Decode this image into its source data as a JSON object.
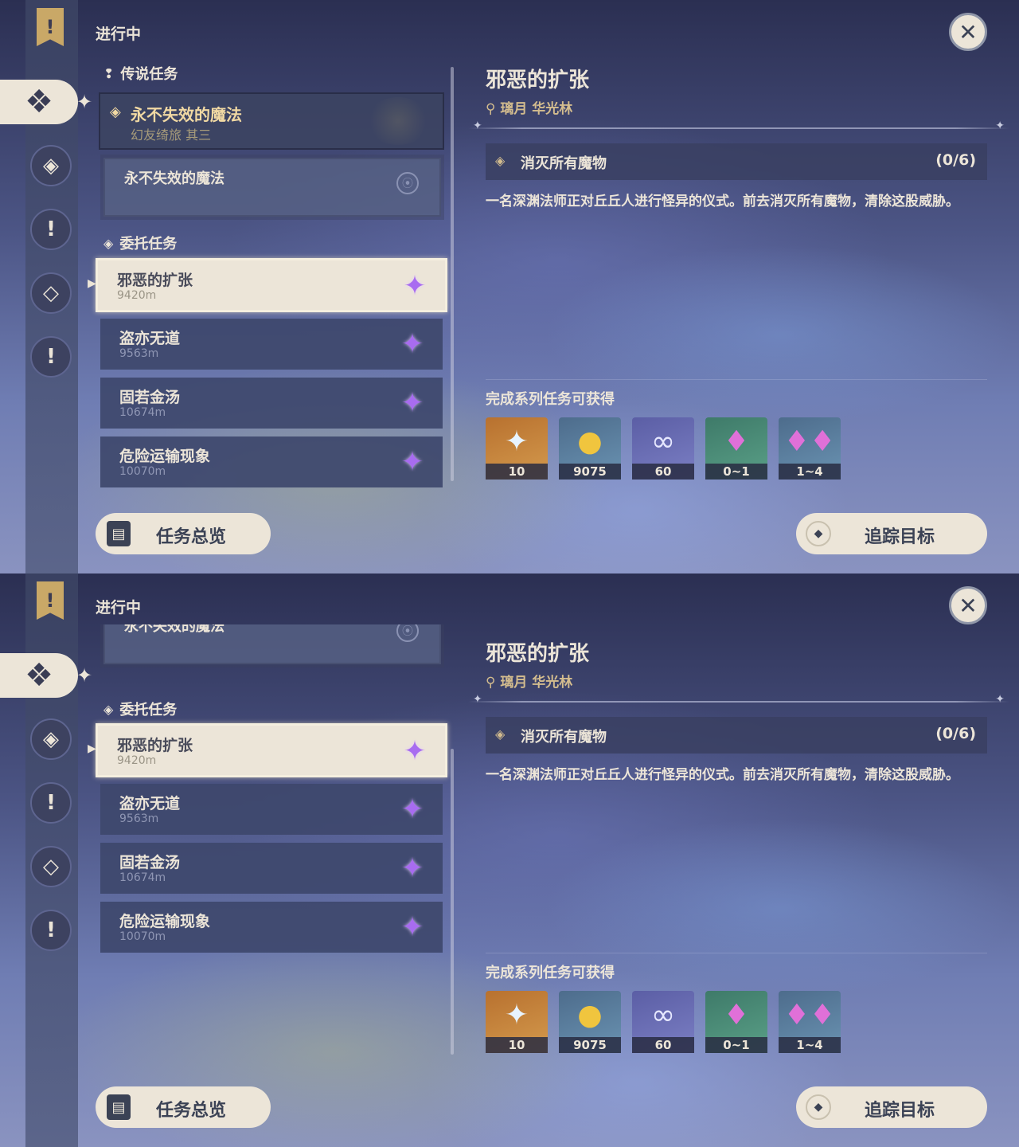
{
  "header": {
    "title": "进行中",
    "close_icon": "close-icon"
  },
  "sections": {
    "legend": {
      "label": "传说任务"
    },
    "commission": {
      "label": "委托任务"
    }
  },
  "legend_quest": {
    "title": "永不失效的魔法",
    "subtitle": "幻友绮旅 其三",
    "sub_item": "永不失效的魔法"
  },
  "quests": [
    {
      "name": "邪恶的扩张",
      "distance": "9420m"
    },
    {
      "name": "盗亦无道",
      "distance": "9563m"
    },
    {
      "name": "固若金汤",
      "distance": "10674m"
    },
    {
      "name": "危险运输现象",
      "distance": "10070m"
    }
  ],
  "detail": {
    "title": "邪恶的扩张",
    "location": "璃月 华光林",
    "objective": "消灭所有魔物",
    "progress": "(0/6)",
    "description": "一名深渊法师正对丘丘人进行怪异的仪式。前去消灭所有魔物，清除这股威胁。",
    "rewards_label": "完成系列任务可获得",
    "rewards": [
      {
        "icon": "primogem-icon",
        "count": "10"
      },
      {
        "icon": "mora-icon",
        "count": "9075"
      },
      {
        "icon": "companionship-exp-icon",
        "count": "60"
      },
      {
        "icon": "crystal-chunk-icon",
        "count": "0~1"
      },
      {
        "icon": "crystal-cluster-icon",
        "count": "1~4"
      }
    ]
  },
  "buttons": {
    "overview": "任务总览",
    "track": "追踪目标"
  },
  "colors": {
    "accent": "#ece5d8",
    "gold": "#d3bc8e",
    "panel": "#3e486c",
    "star": "#a86cf0"
  }
}
